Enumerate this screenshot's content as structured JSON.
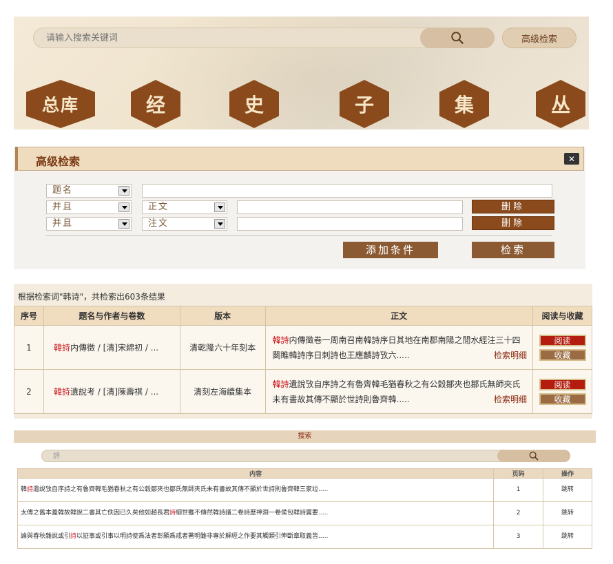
{
  "banner": {
    "search_placeholder": "请输入搜索关键词",
    "advanced_button": "高级检索",
    "categories": [
      "总库",
      "经",
      "史",
      "子",
      "集",
      "丛"
    ]
  },
  "advanced": {
    "title": "高级检索",
    "rows": [
      {
        "field": "题名"
      },
      {
        "logic": "并且",
        "field": "正文",
        "delete": "删除"
      },
      {
        "logic": "并且",
        "field": "注文",
        "delete": "删除"
      }
    ],
    "add_condition": "添加条件",
    "search": "检索"
  },
  "results": {
    "info": "根据检索词\"韩诗\"，共检索出603条结果",
    "headers": [
      "序号",
      "题名与作者与卷数",
      "版本",
      "正文",
      "阅读与收藏"
    ],
    "rows": [
      {
        "no": "1",
        "title_hl": "韓詩",
        "title_rest": "内傳徵 / [清]宋綿初 / ...",
        "edition": "清乾隆六十年刻本",
        "text_hl": "韓詩",
        "text_rest": "内傳徵卷一周南召南韓詩序日其地在南郡南陽之閒水經注三十四鬬睢韓詩序日刺詩也王應麟詩攷六.....",
        "detail": "检索明细",
        "read": "阅读",
        "fav": "收藏"
      },
      {
        "no": "2",
        "title_hl": "韓詩",
        "title_rest": "遺說考 / [清]陳壽祺 / ...",
        "edition": "清刻左海續集本",
        "text_hl": "韓詩",
        "text_rest": "遺說攷自序詩之有魯齊韓毛猶春秋之有公穀鄒夾也鄒氏無師夾氏未有書故其傳不顯於世詩則魯齊韓.....",
        "detail": "检索明细",
        "read": "阅读",
        "fav": "收藏"
      }
    ]
  },
  "inner": {
    "title": "搜索",
    "search_value": "詩",
    "headers": [
      "内容",
      "页码",
      "操作"
    ],
    "rows": [
      {
        "pre": "韓",
        "hl": "詩",
        "post": "遺說攷自序詩之有魯齊韓毛猶春秋之有公穀鄒夾也鄒氏無師夾氏未有書故其傳不顯於世詩則魯齊韓三家竝.....",
        "page": "1",
        "op": "跳转"
      },
      {
        "pre": "太傅之舊本蓋韓故韓說二書其亡佚因已久矣他如趙長君",
        "hl": "詩",
        "post": "細世雖不傳然韓詩譜二卷詩歷神淵一卷侯包韓詩翼要.....",
        "page": "2",
        "op": "跳转"
      },
      {
        "pre": "論與春秋雜說或引",
        "hl": "詩",
        "post": "以証事或引事以明詩使爲法者彰顯爲戒者著明雖非專於解經之作要其觸類引伸斷章取義皆.....",
        "page": "3",
        "op": "跳转"
      }
    ]
  },
  "colors": {
    "brown": "#8b4a1c",
    "red": "#c8141b"
  }
}
